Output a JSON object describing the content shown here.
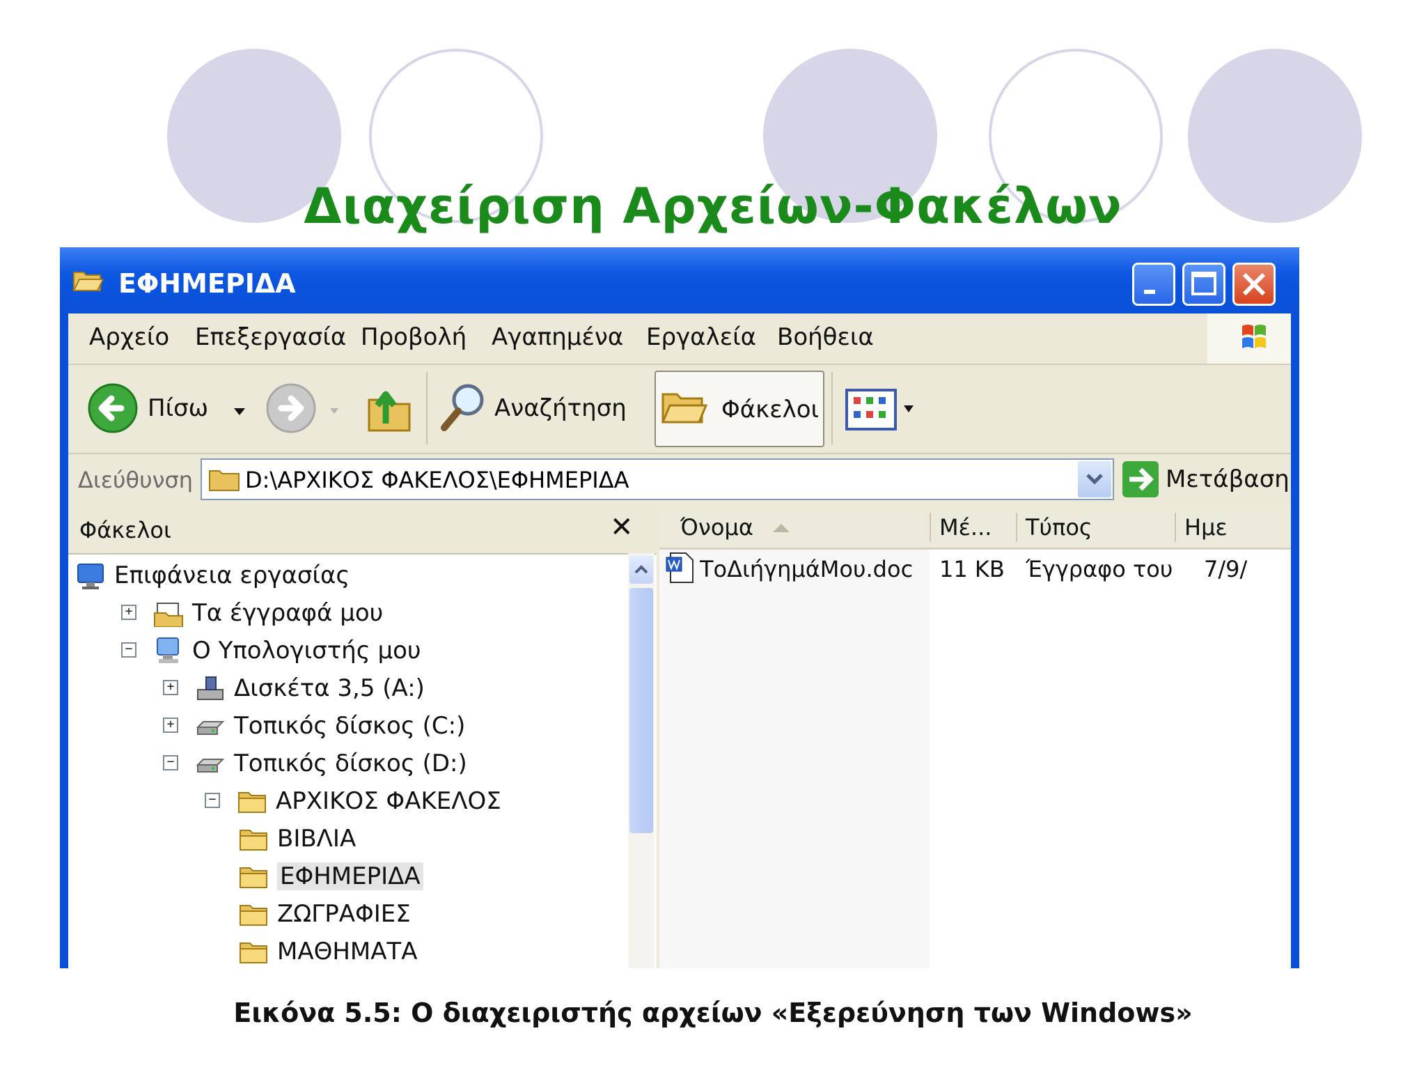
{
  "slide": {
    "title": "Διαχείριση Αρχείων-Φακέλων",
    "caption": "Εικόνα 5.5: Ο διαχειριστής αρχείων «Εξερεύνηση των Windows»"
  },
  "window": {
    "title": "ΕΦΗΜΕΡΙΔΑ",
    "icons": {
      "app": "folder-open-icon",
      "minimize": "minimize-icon",
      "maximize": "maximize-icon",
      "close": "close-icon"
    }
  },
  "menu": {
    "items": [
      "Αρχείο",
      "Επεξεργασία",
      "Προβολή",
      "Αγαπημένα",
      "Εργαλεία",
      "Βοήθεια"
    ]
  },
  "toolbar": {
    "back_label": "Πίσω",
    "search_label": "Αναζήτηση",
    "folders_label": "Φάκελοι"
  },
  "address": {
    "label": "Διεύθυνση",
    "path": "D:\\ΑΡΧΙΚΟΣ ΦΑΚΕΛΟΣ\\ΕΦΗΜΕΡΙΔΑ",
    "go_label": "Μετάβαση"
  },
  "folders_pane": {
    "title": "Φάκελοι",
    "close_glyph": "✕",
    "tree": [
      {
        "label": "Επιφάνεια εργασίας",
        "expander": "",
        "icon": "desktop-icon"
      },
      {
        "label": "Τα έγγραφά μου",
        "expander": "+",
        "icon": "my-documents-icon"
      },
      {
        "label": "Ο Υπολογιστής μου",
        "expander": "−",
        "icon": "my-computer-icon"
      },
      {
        "label": "Δισκέτα 3,5 (A:)",
        "expander": "+",
        "icon": "floppy-drive-icon"
      },
      {
        "label": "Τοπικός δίσκος (C:)",
        "expander": "+",
        "icon": "hard-drive-icon"
      },
      {
        "label": "Τοπικός δίσκος (D:)",
        "expander": "−",
        "icon": "hard-drive-icon"
      },
      {
        "label": "ΑΡΧΙΚΟΣ ΦΑΚΕΛΟΣ",
        "expander": "−",
        "icon": "folder-icon"
      },
      {
        "label": "ΒΙΒΛΙΑ",
        "expander": "",
        "icon": "folder-icon"
      },
      {
        "label": "ΕΦΗΜΕΡΙΔΑ",
        "expander": "",
        "icon": "folder-icon",
        "selected": true
      },
      {
        "label": "ΖΩΓΡΑΦΙΕΣ",
        "expander": "",
        "icon": "folder-icon"
      },
      {
        "label": "ΜΑΘΗΜΑΤΑ",
        "expander": "",
        "icon": "folder-icon"
      }
    ]
  },
  "files_pane": {
    "columns": [
      "Όνομα",
      "Μέ...",
      "Τύπος",
      "Ημε"
    ],
    "rows": [
      {
        "name": "ΤοΔιήγημάΜου.doc",
        "size": "11 KB",
        "type": "Έγγραφο του ...",
        "date": "7/9/"
      }
    ]
  },
  "colors": {
    "title_green": "#1a8a1a",
    "titlebar_blue": "#0a4fd8",
    "circle": "#d6d6e8"
  }
}
